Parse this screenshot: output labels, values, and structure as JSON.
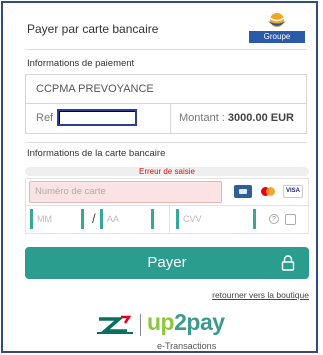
{
  "header": {
    "title": "Payer par carte bancaire",
    "brand": "Groupe AGRICA"
  },
  "payment_info": {
    "section_label": "Informations de paiement",
    "merchant": "CCPMA PREVOYANCE",
    "ref_label": "Ref",
    "ref_value": "",
    "amount_label": "Montant : ",
    "amount_value": "3000.00 EUR"
  },
  "card_info": {
    "section_label": "Informations de la carte bancaire",
    "error_text": "Erreur de saisie",
    "card_number_placeholder": "Numéro de carte",
    "month_placeholder": "MM",
    "slash": "/",
    "year_placeholder": "AA",
    "cvv_placeholder": "CVV",
    "help_glyph": "?",
    "visa_label": "VISA",
    "card_brands": [
      "cb-icon",
      "mastercard-icon",
      "visa-icon"
    ]
  },
  "actions": {
    "pay_label": "Payer",
    "return_label": "retourner vers la boutique"
  },
  "footer": {
    "brand_up": "up",
    "brand_rest": "2pay",
    "subtitle": "e-Transactions"
  },
  "colors": {
    "accent": "#2a9d8f",
    "frame": "#2f4e7f",
    "error": "#dd1111"
  }
}
